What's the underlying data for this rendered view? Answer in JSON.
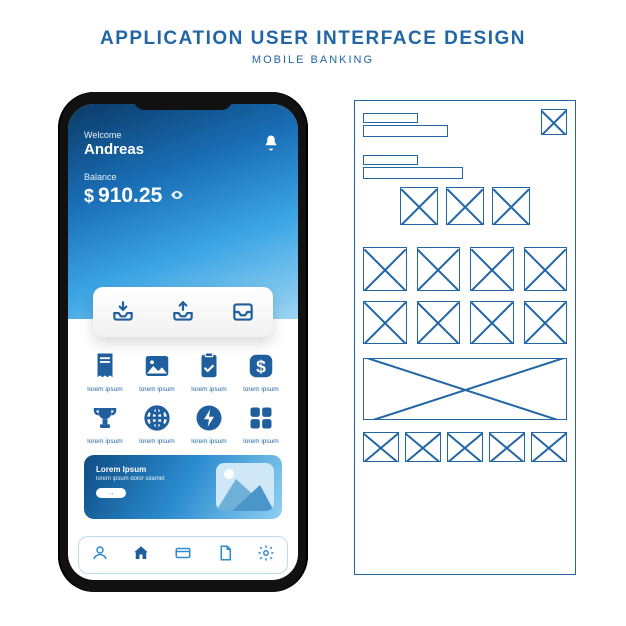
{
  "page": {
    "title": "APPLICATION USER INTERFACE DESIGN",
    "subtitle": "MOBILE BANKING"
  },
  "header": {
    "welcome": "Welcome",
    "username": "Andreas",
    "balance_label": "Balance",
    "currency": "$",
    "balance": "910.25",
    "notification_icon": "bell-icon",
    "visibility_icon": "eye-icon"
  },
  "quick_actions": [
    {
      "name": "deposit",
      "icon": "tray-down-icon"
    },
    {
      "name": "withdraw",
      "icon": "tray-up-icon"
    },
    {
      "name": "inbox",
      "icon": "inbox-icon"
    }
  ],
  "tiles": [
    {
      "name": "receipt",
      "label": "lorem ipsum",
      "icon": "receipt-icon"
    },
    {
      "name": "image",
      "label": "lorem ipsum",
      "icon": "image-icon"
    },
    {
      "name": "clipboard",
      "label": "lorem ipsum",
      "icon": "clipboard-icon"
    },
    {
      "name": "dollar",
      "label": "lorem ipsum",
      "icon": "dollar-icon"
    },
    {
      "name": "trophy",
      "label": "lorem ipsum",
      "icon": "trophy-icon"
    },
    {
      "name": "globe",
      "label": "lorem ipsum",
      "icon": "globe-icon"
    },
    {
      "name": "bolt",
      "label": "lorem ipsum",
      "icon": "bolt-icon"
    },
    {
      "name": "apps",
      "label": "lorem ipsum",
      "icon": "apps-icon"
    }
  ],
  "banner": {
    "title": "Lorem Ipsum",
    "subtitle": "lorem ipsum dolor sitamet",
    "cta_icon": "arrow-right-icon",
    "image": "mountains"
  },
  "navbar": [
    {
      "name": "profile",
      "icon": "user-icon",
      "active": false
    },
    {
      "name": "home",
      "icon": "home-icon",
      "active": true
    },
    {
      "name": "cards",
      "icon": "card-icon",
      "active": false
    },
    {
      "name": "docs",
      "icon": "document-icon",
      "active": false
    },
    {
      "name": "settings",
      "icon": "gear-icon",
      "active": false
    }
  ],
  "colors": {
    "primary": "#2266a5",
    "accent": "#3ca5e4"
  }
}
